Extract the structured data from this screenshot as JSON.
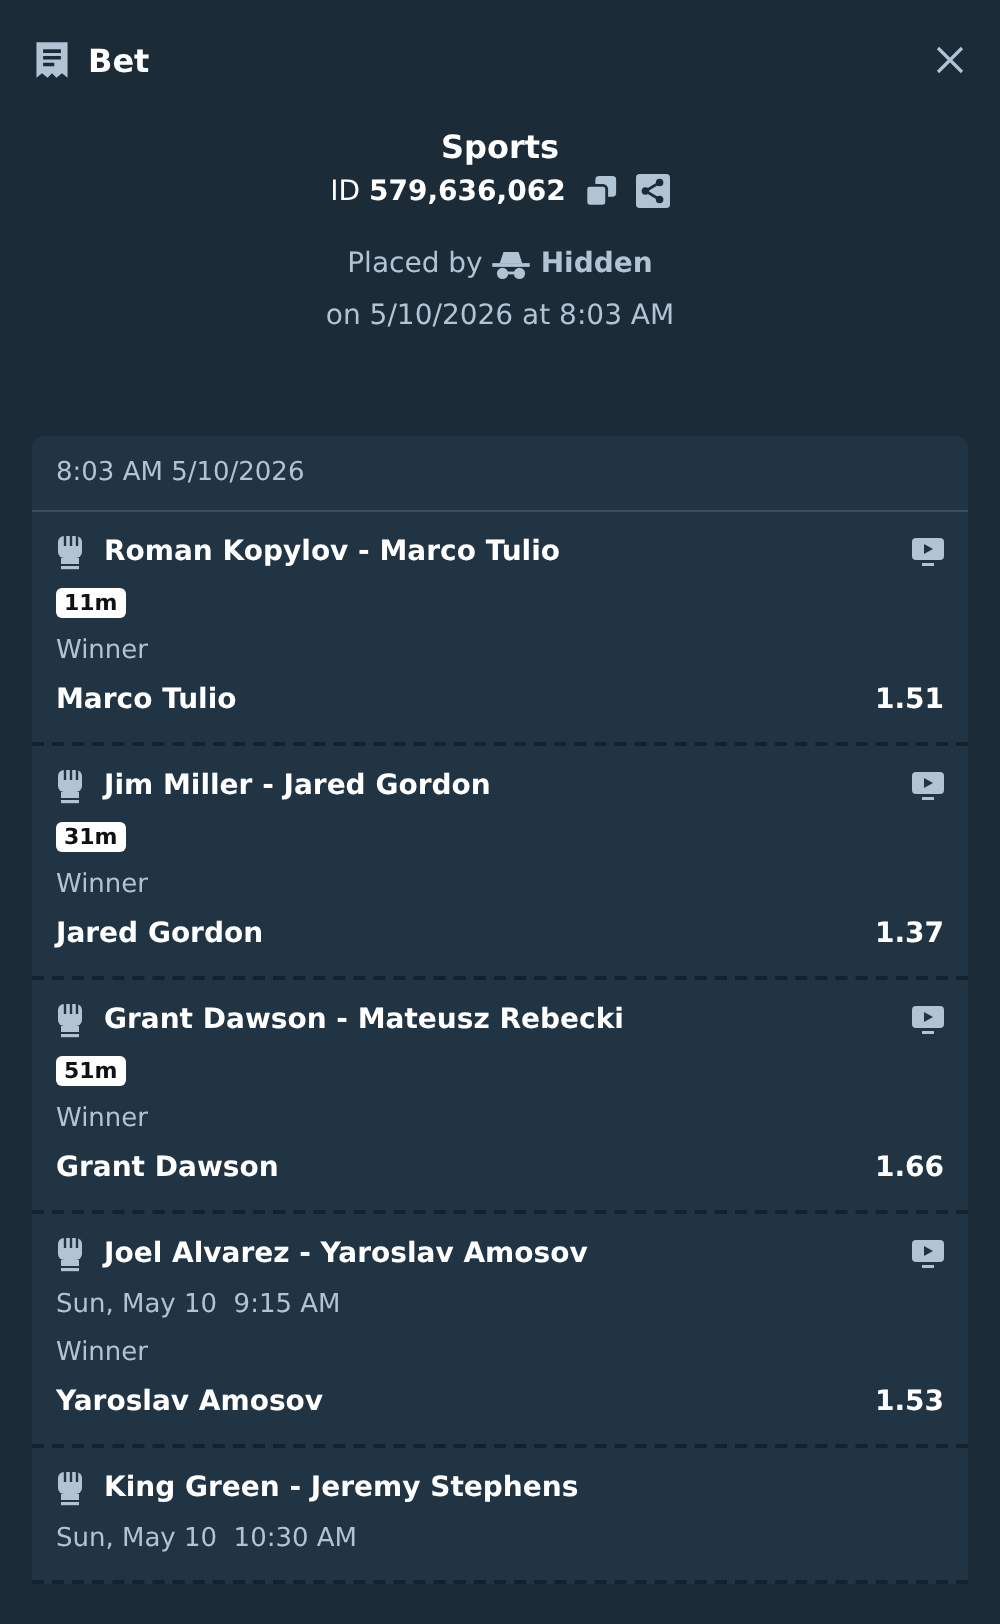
{
  "header": {
    "title": "Bet"
  },
  "bet": {
    "category": "Sports",
    "id_label": "ID",
    "id_value": "579,636,062",
    "placed_by_label": "Placed by",
    "placed_by_user": "Hidden",
    "placed_on": "on 5/10/2026 at 8:03 AM"
  },
  "card": {
    "timestamp": "8:03 AM 5/10/2026",
    "legs": [
      {
        "event": "Roman Kopylov - Marco Tulio",
        "stream": true,
        "status": {
          "kind": "live",
          "text": "11m"
        },
        "market": "Winner",
        "selection": "Marco Tulio",
        "odds": "1.51"
      },
      {
        "event": "Jim Miller - Jared Gordon",
        "stream": true,
        "status": {
          "kind": "live",
          "text": "31m"
        },
        "market": "Winner",
        "selection": "Jared Gordon",
        "odds": "1.37"
      },
      {
        "event": "Grant Dawson - Mateusz Rebecki",
        "stream": true,
        "status": {
          "kind": "live",
          "text": "51m"
        },
        "market": "Winner",
        "selection": "Grant Dawson",
        "odds": "1.66"
      },
      {
        "event": "Joel Alvarez - Yaroslav Amosov",
        "stream": true,
        "status": {
          "kind": "scheduled",
          "text": "Sun, May 10  9:15 AM"
        },
        "market": "Winner",
        "selection": "Yaroslav Amosov",
        "odds": "1.53"
      },
      {
        "event": "King Green - Jeremy Stephens",
        "stream": false,
        "status": {
          "kind": "scheduled",
          "text": "Sun, May 10  10:30 AM"
        }
      }
    ]
  }
}
